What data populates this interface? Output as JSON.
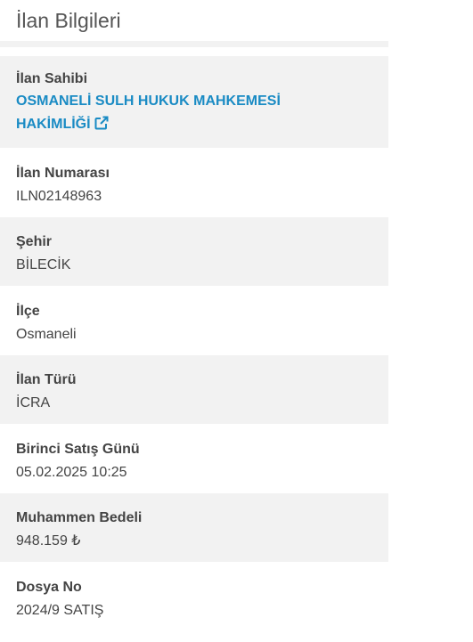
{
  "header": {
    "title": "İlan Bilgileri"
  },
  "colors": {
    "link": "#1a8bc4",
    "row_shade": "#f2f2f2",
    "text": "#444444"
  },
  "owner": {
    "label": "İlan Sahibi",
    "line1": "OSMANELİ SULH HUKUK MAHKEMESİ",
    "line2": "HAKİMLİĞİ",
    "icon": "external-link-icon"
  },
  "fields": {
    "ilan_no": {
      "label": "İlan Numarası",
      "value": "ILN02148963"
    },
    "sehir": {
      "label": "Şehir",
      "value": "BİLECİK"
    },
    "ilce": {
      "label": "İlçe",
      "value": "Osmaneli"
    },
    "ilan_turu": {
      "label": "İlan Türü",
      "value": "İCRA"
    },
    "satis_gunu": {
      "label": "Birinci Satış Günü",
      "value": "05.02.2025 10:25"
    },
    "bedel": {
      "label": "Muhammen Bedeli",
      "value": "948.159 ₺"
    },
    "dosya_no": {
      "label": "Dosya No",
      "value": "2024/9 SATIŞ"
    }
  }
}
